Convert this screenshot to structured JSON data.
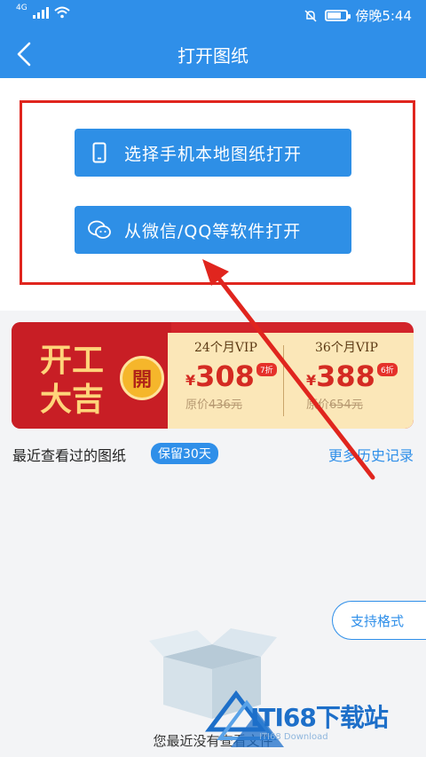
{
  "status_bar": {
    "network": "4G",
    "time": "傍晚5:44",
    "icons": [
      "signal-icon",
      "wifi-icon",
      "mute-icon",
      "battery-icon"
    ]
  },
  "nav": {
    "title": "打开图纸",
    "back_icon": "chevron-left-icon"
  },
  "open_actions": [
    {
      "label": "选择手机本地图纸打开",
      "icon": "phone-icon"
    },
    {
      "label": "从微信/QQ等软件打开",
      "icon": "wechat-icon"
    }
  ],
  "promo_banner": {
    "bless_line1": "开工",
    "bless_line2": "大吉",
    "seal": "開",
    "plans": [
      {
        "name": "24个月VIP",
        "yen": "¥",
        "price": "308",
        "discount": "7折",
        "orig_prefix": "原价",
        "orig_price": "436元"
      },
      {
        "name": "36个月VIP",
        "yen": "¥",
        "price": "388",
        "discount": "6折",
        "orig_prefix": "原价",
        "orig_price": "654元"
      }
    ]
  },
  "recent": {
    "title": "最近查看过的图纸",
    "keep_badge": "保留30天",
    "more_link": "更多历史记录"
  },
  "format_button": "支持格式",
  "empty_state": {
    "text": "您最近没有查看文件"
  },
  "watermark": {
    "text": "ITI68下载站",
    "sub": "ITI68 Download"
  },
  "colors": {
    "primary": "#2f8fe9",
    "highlight_frame": "#e0251e",
    "banner_red": "#d2242a",
    "banner_cream": "#fbe7b8"
  }
}
